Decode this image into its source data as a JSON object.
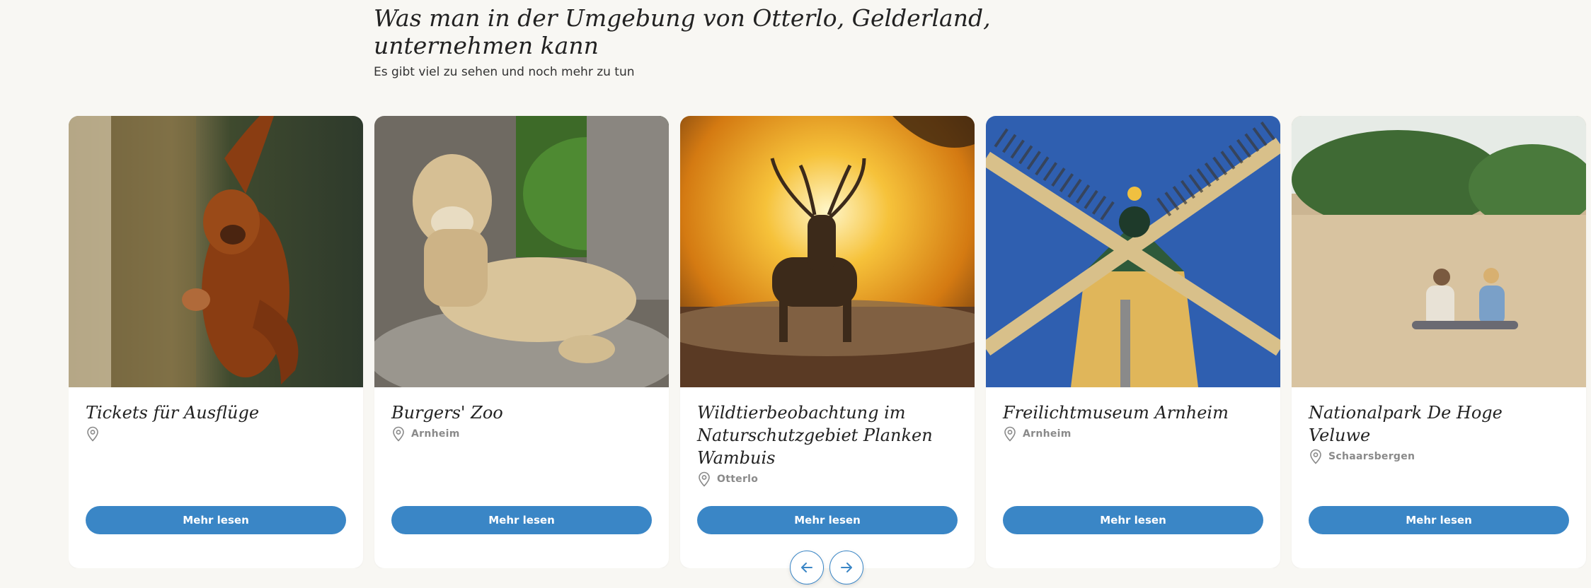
{
  "section": {
    "title": "Was man in der Umgebung von Otterlo, Gelderland, unternehmen kann",
    "subtitle": "Es gibt viel zu sehen und noch mehr zu tun"
  },
  "cards": [
    {
      "title": "Tickets für Ausflüge",
      "location": "",
      "button": "Mehr lesen",
      "image": "orangutan-photo"
    },
    {
      "title": "Burgers' Zoo",
      "location": "Arnheim",
      "button": "Mehr lesen",
      "image": "lioness-photo"
    },
    {
      "title": "Wildtierbeobachtung im Naturschutzgebiet Planken Wambuis",
      "location": "Otterlo",
      "button": "Mehr lesen",
      "image": "deer-sunset-photo"
    },
    {
      "title": "Freilichtmuseum Arnheim",
      "location": "Arnheim",
      "button": "Mehr lesen",
      "image": "windmill-photo"
    },
    {
      "title": "Nationalpark De Hoge Veluwe",
      "location": "Schaarsbergen",
      "button": "Mehr lesen",
      "image": "dunes-picnic-photo"
    }
  ],
  "navigation": {
    "prev_icon": "arrow-left-icon",
    "next_icon": "arrow-right-icon"
  },
  "colors": {
    "accent": "#3a86c6",
    "background": "#f8f7f3",
    "card": "#ffffff"
  }
}
